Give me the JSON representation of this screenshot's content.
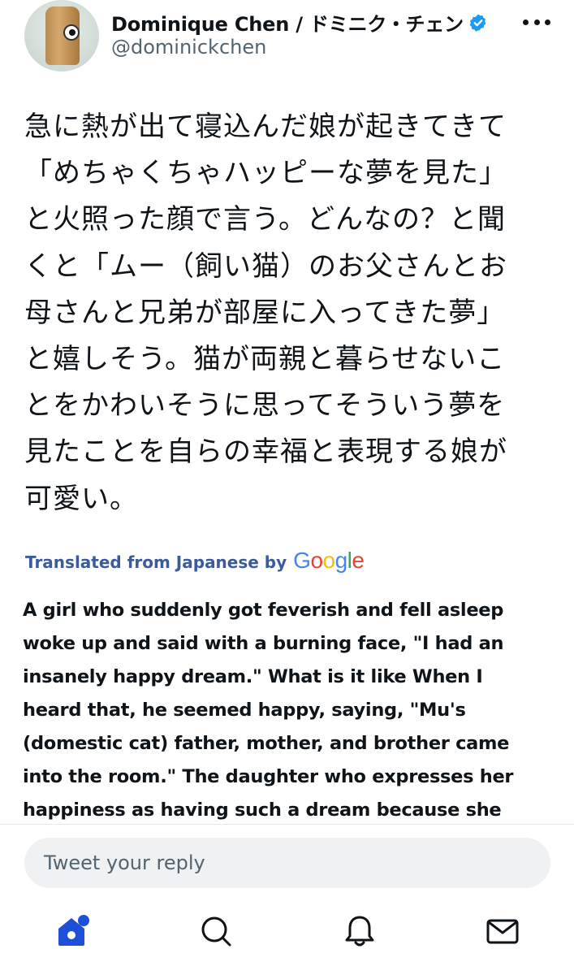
{
  "author": {
    "display_name": "Dominique Chen / ドミニク・チェン",
    "handle": "@dominickchen",
    "verified": true
  },
  "tweet": {
    "lines": [
      "急に熱が出て寝込んだ娘が起きてきて",
      "「めちゃくちゃハッピーな夢を見た」",
      "と火照った顔で言う。どんなの？と聞",
      "くと「ムー（飼い猫）のお父さんとお",
      "母さんと兄弟が部屋に入ってきた夢」",
      "と嬉しそう。猫が両親と暮らせないこ",
      "とをかわいそうに思ってそういう夢を",
      "見たことを自らの幸福と表現する娘が",
      "可愛い。"
    ]
  },
  "translation": {
    "label": "Translated from Japanese by",
    "provider": "Google",
    "lines": [
      "A girl who suddenly got feverish and fell asleep",
      "woke up and said with a burning face, \"I had an",
      "insanely happy dream.\" What is it like When I",
      "heard that, he seemed happy, saying, \"Mu's",
      "(domestic cat) father, mother, and brother came",
      "into the room.\" The daughter who expresses her",
      "happiness as having such a dream because she"
    ]
  },
  "reply": {
    "placeholder": "Tweet your reply"
  },
  "nav": {
    "items": [
      {
        "icon": "home-icon",
        "active": true,
        "has_notification_dot": true
      },
      {
        "icon": "search-icon",
        "active": false
      },
      {
        "icon": "bell-icon",
        "active": false
      },
      {
        "icon": "mail-icon",
        "active": false
      }
    ]
  },
  "colors": {
    "accent": "#1d4fd8",
    "verified_badge": "#1d9bf0",
    "translated_label": "#3b5b99",
    "secondary_text": "#536471",
    "reply_bg": "#eff1f3"
  }
}
